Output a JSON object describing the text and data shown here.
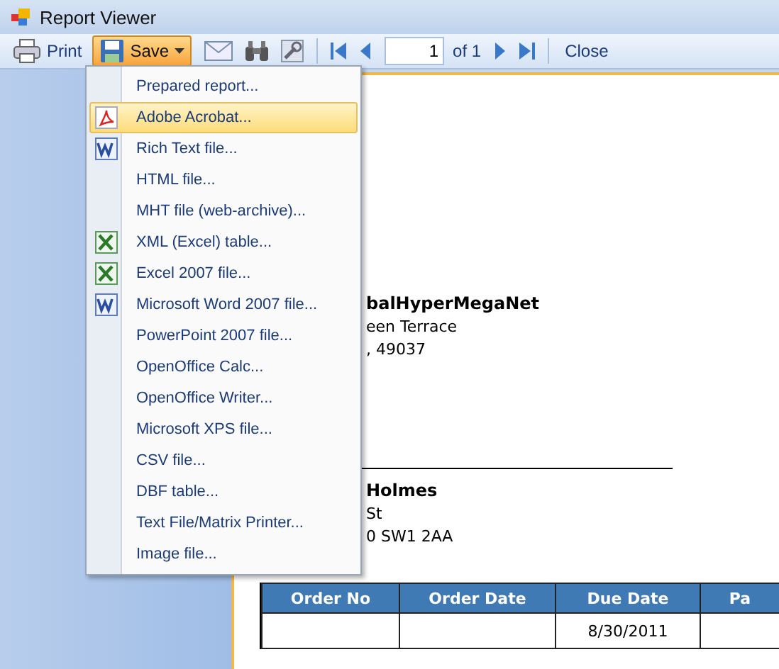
{
  "window": {
    "title": "Report Viewer"
  },
  "toolbar": {
    "print": "Print",
    "save": "Save",
    "page_value": "1",
    "page_of": "of 1",
    "close": "Close"
  },
  "save_menu": [
    {
      "label": "Prepared report...",
      "kind": "plain",
      "selected": false
    },
    {
      "label": "Adobe Acrobat...",
      "kind": "acrobat",
      "selected": true
    },
    {
      "label": "Rich Text file...",
      "kind": "word",
      "selected": false
    },
    {
      "label": "HTML file...",
      "kind": "plain",
      "selected": false
    },
    {
      "label": "MHT file (web-archive)...",
      "kind": "plain",
      "selected": false
    },
    {
      "label": "XML (Excel) table...",
      "kind": "excel",
      "selected": false
    },
    {
      "label": "Excel 2007 file...",
      "kind": "excel",
      "selected": false
    },
    {
      "label": "Microsoft Word 2007 file...",
      "kind": "word",
      "selected": false
    },
    {
      "label": "PowerPoint 2007 file...",
      "kind": "plain",
      "selected": false
    },
    {
      "label": "OpenOffice Calc...",
      "kind": "plain",
      "selected": false
    },
    {
      "label": "OpenOffice Writer...",
      "kind": "plain",
      "selected": false
    },
    {
      "label": "Microsoft XPS file...",
      "kind": "plain",
      "selected": false
    },
    {
      "label": "CSV file...",
      "kind": "plain",
      "selected": false
    },
    {
      "label": "DBF table...",
      "kind": "plain",
      "selected": false
    },
    {
      "label": "Text File/Matrix Printer...",
      "kind": "plain",
      "selected": false
    },
    {
      "label": "Image file...",
      "kind": "plain",
      "selected": false
    }
  ],
  "report": {
    "sender": {
      "name": "balHyperMegaNet",
      "lines": [
        "een Terrace",
        ", 49037"
      ]
    },
    "recipient": {
      "name": "Holmes",
      "lines": [
        "St",
        "0 SW1 2AA"
      ]
    },
    "table": {
      "columns": [
        "Order No",
        "Order Date",
        "Due Date",
        "Pa"
      ],
      "rows": [
        [
          "",
          "",
          "8/30/2011",
          ""
        ]
      ]
    }
  }
}
